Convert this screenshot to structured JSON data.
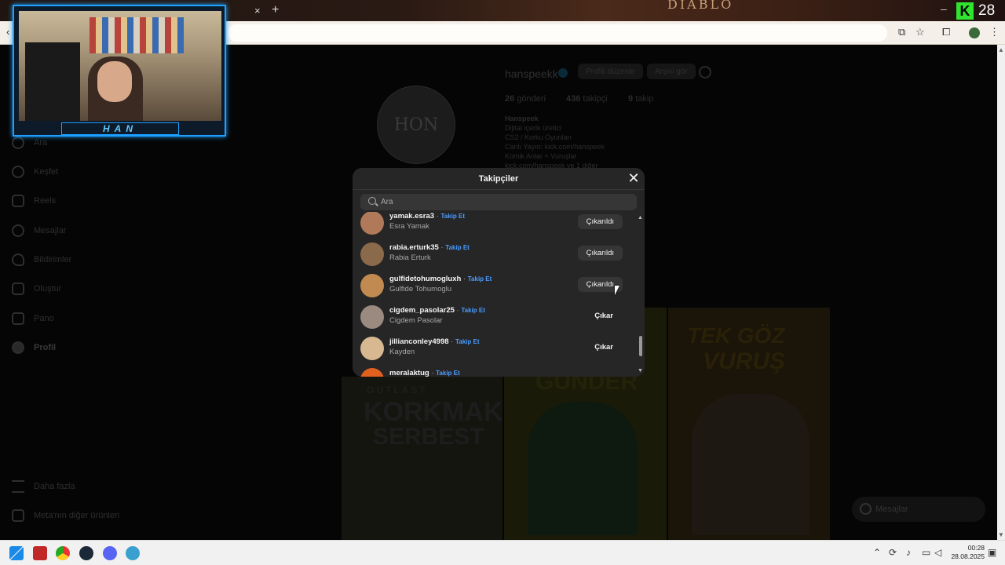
{
  "browser": {
    "new_tab_label": "+",
    "close_tab_label": "×",
    "banner_text": "DIABLO",
    "minimize_label": "–",
    "kick_logo": "K",
    "kick_count": "28"
  },
  "webcam": {
    "nameplate": "HAN"
  },
  "sidebar": {
    "items": [
      {
        "label": "Ara",
        "icon": "search-icon"
      },
      {
        "label": "Keşfet",
        "icon": "compass-icon"
      },
      {
        "label": "Reels",
        "icon": "reels-icon"
      },
      {
        "label": "Mesajlar",
        "icon": "messenger-icon"
      },
      {
        "label": "Bildirimler",
        "icon": "heart-icon"
      },
      {
        "label": "Oluştur",
        "icon": "plus-square-icon"
      },
      {
        "label": "Pano",
        "icon": "chart-icon"
      },
      {
        "label": "Profil",
        "icon": "avatar-icon"
      }
    ],
    "more_label": "Daha fazla",
    "meta_label": "Meta'nın diğer ürünleri"
  },
  "profile": {
    "username": "hanspeekk",
    "edit_button": "Profili düzenle",
    "archive_button": "Arşivi gör",
    "posts_count": "26",
    "posts_label": "gönderi",
    "followers_count": "436",
    "followers_label": "takipçi",
    "following_count": "9",
    "following_label": "takip",
    "display_name": "Hanspeek",
    "category": "Dijital içerik üretici",
    "bio": [
      "CS2 / Korku Oyunları",
      "Canlı Yayın: kick.com/hanspeek",
      "Komik Anlar + Vuruşlar",
      "kick.com/hanspeek ve 1 diğer"
    ],
    "avatar_text": "HON",
    "thumbnails": [
      {
        "line1": "OUTLAST",
        "line2": "KORKMAK",
        "line3": "SERBEST"
      },
      {
        "line1": "GÜNDER"
      },
      {
        "line1": "TEK GÖZ",
        "line2": "VURUŞ"
      }
    ]
  },
  "messages_pill": {
    "label": "Mesajlar"
  },
  "modal": {
    "title": "Takipçiler",
    "search_placeholder": "Ara",
    "follow_label": "Takip Et",
    "separator": "·",
    "rows": [
      {
        "username": "yamak.esra3",
        "full_name": "Esra Yamak",
        "action": "Çıkarıldı",
        "avatar_color": "#b07a5a"
      },
      {
        "username": "rabia.erturk35",
        "full_name": "Rabia Erturk",
        "action": "Çıkarıldı",
        "avatar_color": "#8a6a4a"
      },
      {
        "username": "gulfidetohumogluxh",
        "full_name": "Gulfide Tohumoglu",
        "action": "Çıkarıldı",
        "avatar_color": "#c08a50"
      },
      {
        "username": "cigdem_pasolar25",
        "full_name": "Cigdem Pasolar",
        "action": "Çıkar",
        "avatar_color": "#9a8a80"
      },
      {
        "username": "jillianconley4998",
        "full_name": "Kayden",
        "action": "Çıkar",
        "avatar_color": "#d8b890"
      },
      {
        "username": "meralaktug",
        "full_name": "",
        "action": "",
        "avatar_color": "#e06020"
      }
    ]
  },
  "taskbar": {
    "time": "00:28",
    "date": "28.08.2025"
  }
}
